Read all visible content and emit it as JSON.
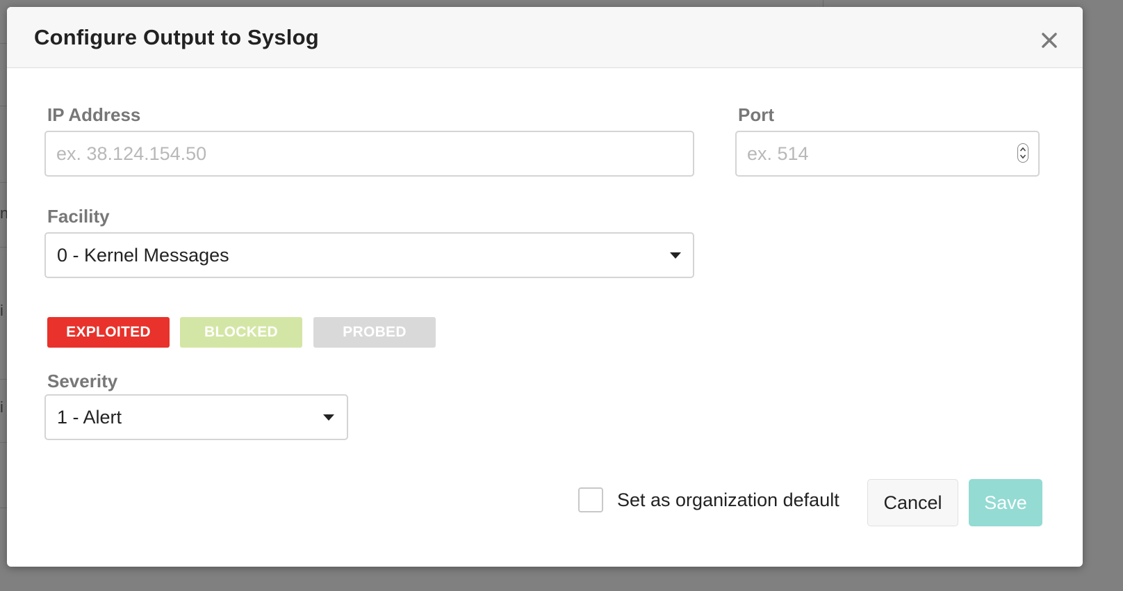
{
  "background": {
    "peek_chars": [
      "n",
      "i",
      "i"
    ]
  },
  "modal": {
    "title": "Configure Output to Syslog",
    "close_icon": "close-icon",
    "ip_address": {
      "label": "IP Address",
      "placeholder": "ex. 38.124.154.50",
      "value": ""
    },
    "port": {
      "label": "Port",
      "placeholder": "ex. 514",
      "value": ""
    },
    "facility": {
      "label": "Facility",
      "selected": "0 - Kernel Messages"
    },
    "tags": [
      {
        "label": "EXPLOITED",
        "color": "#e8322b",
        "active": true
      },
      {
        "label": "BLOCKED",
        "color": "#d4e6a5",
        "active": false
      },
      {
        "label": "PROBED",
        "color": "#d9d9d9",
        "active": false
      }
    ],
    "severity": {
      "label": "Severity",
      "selected": "1 - Alert"
    },
    "org_default": {
      "label": "Set as organization default",
      "checked": false
    },
    "buttons": {
      "cancel": "Cancel",
      "save": "Save"
    },
    "colors": {
      "save_disabled": "#93dbd3",
      "label_gray": "#777777"
    }
  }
}
